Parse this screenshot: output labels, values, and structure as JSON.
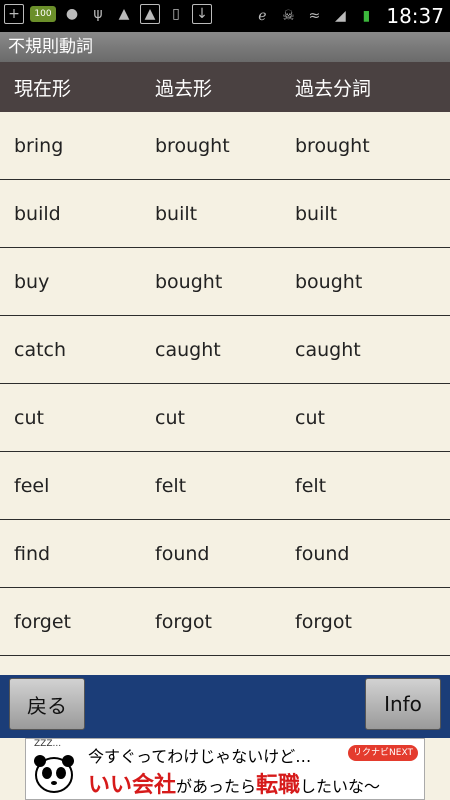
{
  "statusbar": {
    "time": "18:37",
    "left_icons": [
      "add-icon",
      "battery-100-icon",
      "android-icon",
      "usb-icon",
      "android-debug-icon",
      "image-icon",
      "phone-icon",
      "download-icon"
    ],
    "right_icons": [
      "bluetooth-icon",
      "skull-icon",
      "wifi-icon",
      "signal-icon",
      "battery-icon"
    ]
  },
  "app": {
    "title": "不規則動詞"
  },
  "table": {
    "headers": [
      "現在形",
      "過去形",
      "過去分詞"
    ],
    "rows": [
      [
        "bring",
        "brought",
        "brought"
      ],
      [
        "build",
        "built",
        "built"
      ],
      [
        "buy",
        "bought",
        "bought"
      ],
      [
        "catch",
        "caught",
        "caught"
      ],
      [
        "cut",
        "cut",
        "cut"
      ],
      [
        "feel",
        "felt",
        "felt"
      ],
      [
        "find",
        "found",
        "found"
      ],
      [
        "forget",
        "forgot",
        "forgot"
      ]
    ]
  },
  "toolbar": {
    "back_label": "戻る",
    "info_label": "Info"
  },
  "ad": {
    "line1": "今すぐってわけじゃないけど…",
    "line2_part1": "いい会社",
    "line2_part2": "があったら",
    "line2_part3": "転職",
    "line2_part4": "したいな〜",
    "brand": "リクナビNEXT",
    "zzz": "ZZZ..."
  }
}
